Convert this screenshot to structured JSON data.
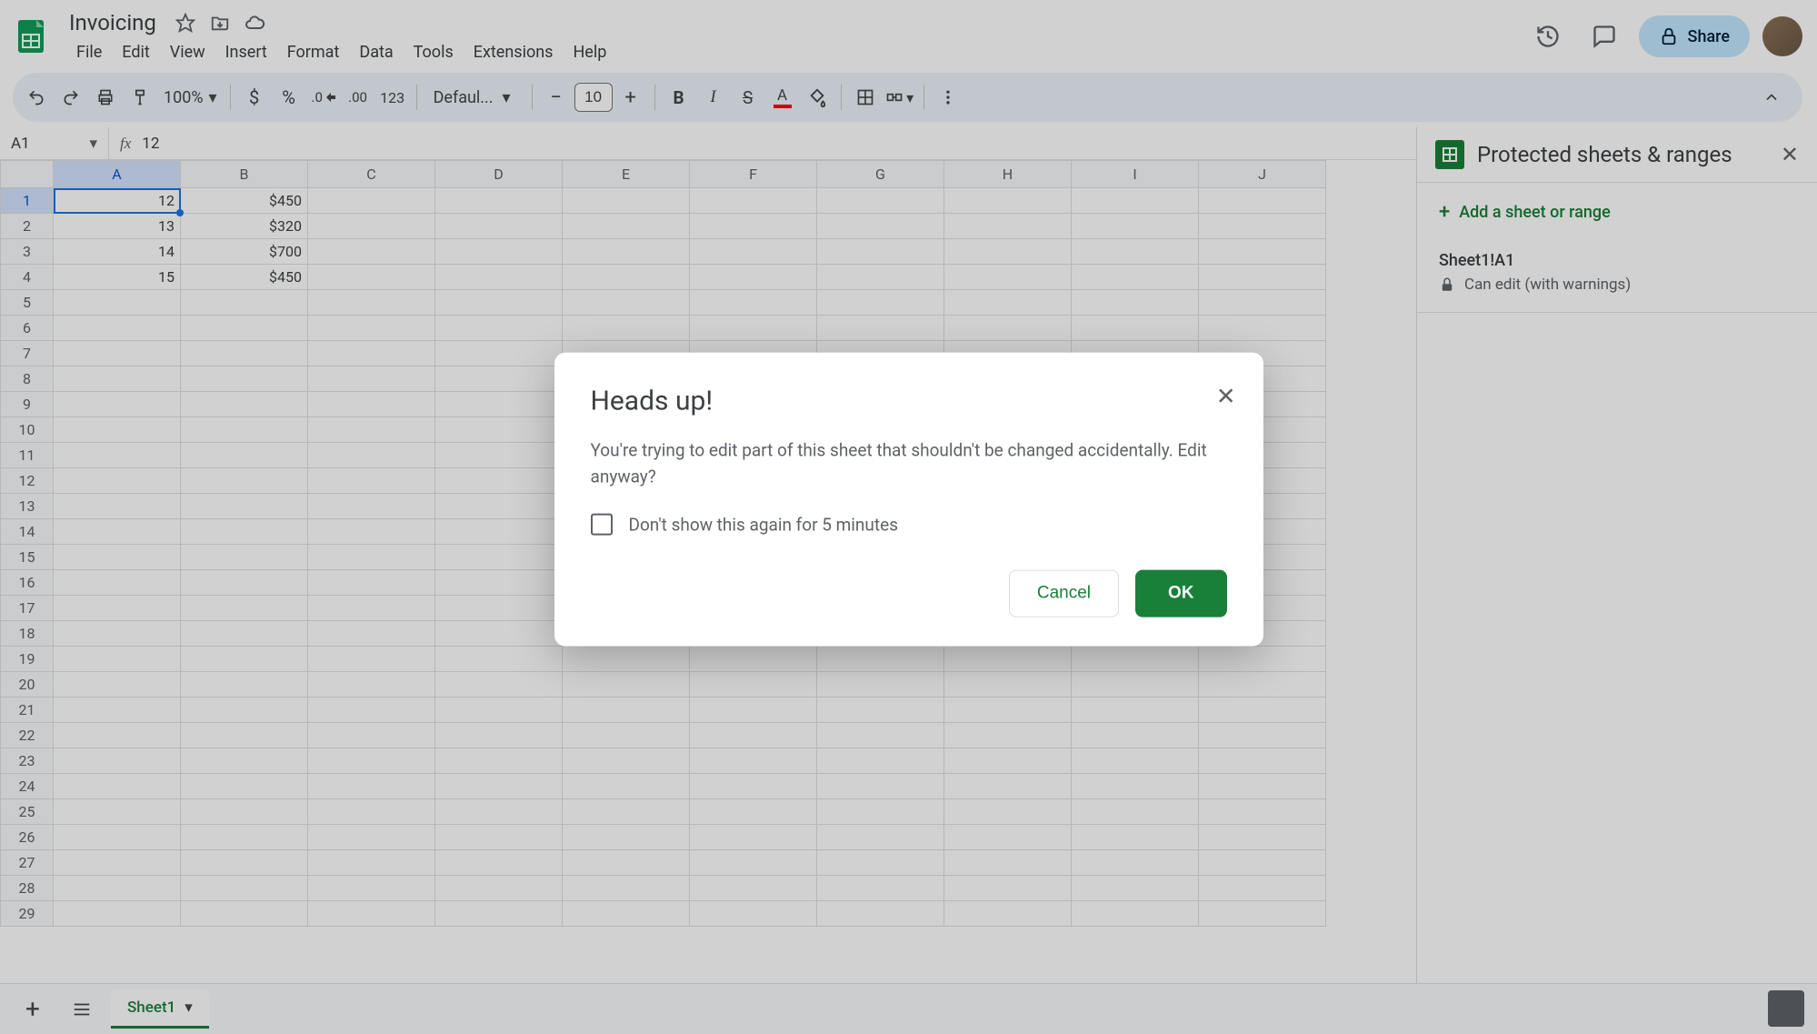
{
  "doc_title": "Invoicing",
  "menus": [
    "File",
    "Edit",
    "View",
    "Insert",
    "Format",
    "Data",
    "Tools",
    "Extensions",
    "Help"
  ],
  "share_label": "Share",
  "toolbar": {
    "zoom": "100%",
    "font": "Defaul...",
    "font_size": "10",
    "fmt_123": "123"
  },
  "namebox": "A1",
  "formula_value": "12",
  "columns": [
    "A",
    "B",
    "C",
    "D",
    "E",
    "F",
    "G",
    "H",
    "I",
    "J"
  ],
  "rows": [
    {
      "n": "1",
      "a": "12",
      "b": "$450"
    },
    {
      "n": "2",
      "a": "13",
      "b": "$320"
    },
    {
      "n": "3",
      "a": "14",
      "b": "$700"
    },
    {
      "n": "4",
      "a": "15",
      "b": "$450"
    },
    {
      "n": "5"
    },
    {
      "n": "6"
    },
    {
      "n": "7"
    },
    {
      "n": "8"
    },
    {
      "n": "9"
    },
    {
      "n": "10"
    },
    {
      "n": "11"
    },
    {
      "n": "12"
    },
    {
      "n": "13"
    },
    {
      "n": "14"
    },
    {
      "n": "15"
    },
    {
      "n": "16"
    },
    {
      "n": "17"
    },
    {
      "n": "18"
    },
    {
      "n": "19"
    },
    {
      "n": "20"
    },
    {
      "n": "21"
    },
    {
      "n": "22"
    },
    {
      "n": "23"
    },
    {
      "n": "24"
    },
    {
      "n": "25"
    },
    {
      "n": "26"
    },
    {
      "n": "27"
    },
    {
      "n": "28"
    },
    {
      "n": "29"
    }
  ],
  "sidebar": {
    "title": "Protected sheets & ranges",
    "add_label": "Add a sheet or range",
    "range_name": "Sheet1!A1",
    "range_desc": "Can edit (with warnings)"
  },
  "tab_name": "Sheet1",
  "modal": {
    "title": "Heads up!",
    "body": "You're trying to edit part of this sheet that shouldn't be changed accidentally. Edit anyway?",
    "checkbox_label": "Don't show this again for 5 minutes",
    "cancel": "Cancel",
    "ok": "OK"
  }
}
